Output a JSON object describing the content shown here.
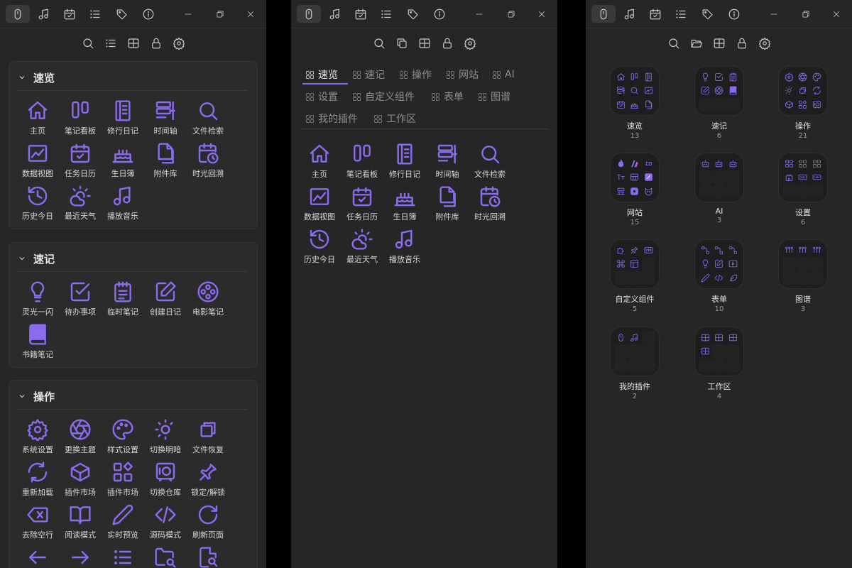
{
  "colors": {
    "accent": "#8b6cf0",
    "panel": "#262626",
    "section": "#2b2b2b",
    "text": "#d6d6d6"
  },
  "titlebar": {
    "tabs": [
      "mouse-icon",
      "music-icon",
      "calendar-check-icon",
      "list-icon",
      "tags-icon",
      "info-icon"
    ],
    "active_tab": "mouse-icon",
    "window_controls": [
      "minimize-icon",
      "restore-icon",
      "close-icon"
    ]
  },
  "toolbars": {
    "panel1": [
      "search-icon",
      "list-icon",
      "layout-icon",
      "lock-icon",
      "gear-icon"
    ],
    "panel2": [
      "search-icon",
      "copy-icon",
      "layout-icon",
      "lock-icon",
      "gear-icon"
    ],
    "panel3": [
      "search-icon",
      "folder-open-icon",
      "layout-icon",
      "lock-icon",
      "gear-icon"
    ]
  },
  "panel1": {
    "sections": [
      {
        "title": "速览",
        "items": [
          {
            "label": "主页",
            "icon": "home"
          },
          {
            "label": "笔记看板",
            "icon": "kanban"
          },
          {
            "label": "修行日记",
            "icon": "notebook"
          },
          {
            "label": "时间轴",
            "icon": "timeline"
          },
          {
            "label": "文件检索",
            "icon": "search"
          },
          {
            "label": "数据视图",
            "icon": "chart"
          },
          {
            "label": "任务日历",
            "icon": "calendar-check"
          },
          {
            "label": "生日簿",
            "icon": "cake"
          },
          {
            "label": "附件库",
            "icon": "files"
          },
          {
            "label": "时光回溯",
            "icon": "calendar-clock"
          },
          {
            "label": "历史今日",
            "icon": "history"
          },
          {
            "label": "最近天气",
            "icon": "weather"
          },
          {
            "label": "播放音乐",
            "icon": "music"
          }
        ]
      },
      {
        "title": "速记",
        "items": [
          {
            "label": "灵光一闪",
            "icon": "bulb"
          },
          {
            "label": "待办事项",
            "icon": "checkbox"
          },
          {
            "label": "临时笔记",
            "icon": "notepad"
          },
          {
            "label": "创建日记",
            "icon": "edit"
          },
          {
            "label": "电影笔记",
            "icon": "film"
          },
          {
            "label": "书籍笔记",
            "icon": "book"
          }
        ]
      },
      {
        "title": "操作",
        "items": [
          {
            "label": "系统设置",
            "icon": "gear"
          },
          {
            "label": "更换主题",
            "icon": "aperture"
          },
          {
            "label": "样式设置",
            "icon": "palette"
          },
          {
            "label": "切换明暗",
            "icon": "sun-moon"
          },
          {
            "label": "文件恢复",
            "icon": "restore"
          },
          {
            "label": "重新加载",
            "icon": "reload"
          },
          {
            "label": "插件市场",
            "icon": "box"
          },
          {
            "label": "插件市场",
            "icon": "shapes"
          },
          {
            "label": "切换仓库",
            "icon": "vault"
          },
          {
            "label": "锁定/解锁",
            "icon": "pin"
          },
          {
            "label": "去除空行",
            "icon": "delete"
          },
          {
            "label": "阅读模式",
            "icon": "open-book"
          },
          {
            "label": "实时预览",
            "icon": "pen"
          },
          {
            "label": "源码模式",
            "icon": "code"
          },
          {
            "label": "刷新页面",
            "icon": "refresh"
          },
          {
            "label": "",
            "icon": "arrow-left"
          },
          {
            "label": "",
            "icon": "arrow-right"
          },
          {
            "label": "",
            "icon": "list"
          },
          {
            "label": "",
            "icon": "folder-search"
          },
          {
            "label": "",
            "icon": "file-search"
          }
        ]
      }
    ]
  },
  "panel2": {
    "tags": [
      "速览",
      "速记",
      "操作",
      "网站",
      "AI",
      "设置",
      "自定义组件",
      "表单",
      "图谱",
      "我的插件",
      "工作区"
    ],
    "active_tag": "速览",
    "items": [
      {
        "label": "主页",
        "icon": "home"
      },
      {
        "label": "笔记看板",
        "icon": "kanban"
      },
      {
        "label": "修行日记",
        "icon": "notebook"
      },
      {
        "label": "时间轴",
        "icon": "timeline"
      },
      {
        "label": "文件检索",
        "icon": "search"
      },
      {
        "label": "数据视图",
        "icon": "chart"
      },
      {
        "label": "任务日历",
        "icon": "calendar-check"
      },
      {
        "label": "生日簿",
        "icon": "cake"
      },
      {
        "label": "附件库",
        "icon": "files"
      },
      {
        "label": "时光回溯",
        "icon": "calendar-clock"
      },
      {
        "label": "历史今日",
        "icon": "history"
      },
      {
        "label": "最近天气",
        "icon": "weather"
      },
      {
        "label": "播放音乐",
        "icon": "music"
      }
    ]
  },
  "panel3": {
    "folders": [
      {
        "name": "速览",
        "count": "13",
        "icons": [
          "home",
          "kanban",
          "notebook",
          "timeline",
          "search",
          "chart",
          "calendar-check",
          "cake",
          "files"
        ]
      },
      {
        "name": "速记",
        "count": "6",
        "icons": [
          "bulb",
          "checkbox",
          "notepad",
          "edit",
          "film",
          "book"
        ]
      },
      {
        "name": "操作",
        "count": "21",
        "icons": [
          "gear",
          "aperture",
          "palette",
          "sun-moon",
          "restore",
          "reload",
          "box",
          "shapes",
          "vault"
        ]
      },
      {
        "name": "网站",
        "count": "15",
        "icons": [
          "flame",
          "slash",
          "co",
          "tt",
          "grid",
          "card",
          "dou",
          "avatar",
          "fox"
        ]
      },
      {
        "name": "AI",
        "count": "3",
        "icons": [
          "bot",
          "bot",
          "bot"
        ]
      },
      {
        "name": "设置",
        "count": "6",
        "icons": [
          "grid4",
          "grid4",
          "grid4",
          "castle",
          "keyboard",
          "keyboard"
        ]
      },
      {
        "name": "自定义组件",
        "count": "5",
        "icons": [
          "puzzle",
          "pin",
          "css",
          "command",
          "form"
        ]
      },
      {
        "name": "表单",
        "count": "10",
        "icons": [
          "nodes",
          "nodes",
          "nodes",
          "bulb",
          "edit",
          "video",
          "pen",
          "code",
          "feather"
        ]
      },
      {
        "name": "图谱",
        "count": "3",
        "icons": [
          "graph",
          "graph",
          "graph"
        ]
      },
      {
        "name": "我的插件",
        "count": "2",
        "icons": [
          "mouse",
          "music"
        ]
      },
      {
        "name": "工作区",
        "count": "4",
        "icons": [
          "layout",
          "layout",
          "layout",
          "layout"
        ]
      }
    ]
  }
}
